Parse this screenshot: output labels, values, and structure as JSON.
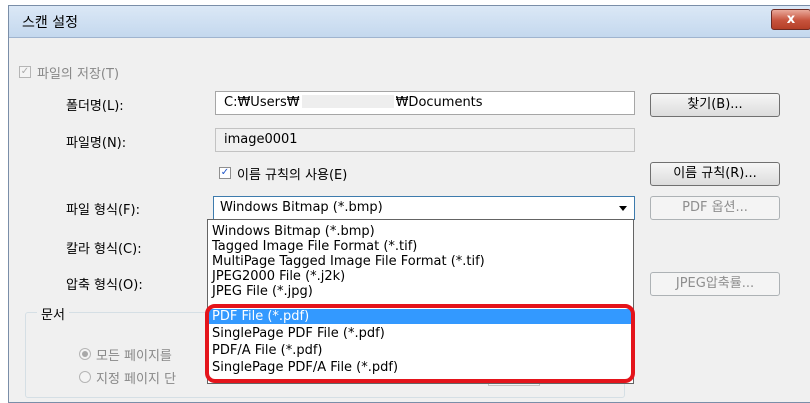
{
  "window": {
    "title": "스캔 설정",
    "close_label": "x"
  },
  "save_file": {
    "label": "파일의 저장(T)",
    "checked": true
  },
  "folder": {
    "label": "폴더명(L):",
    "value": "C:₩Users₩",
    "value_tail": "₩Documents",
    "browse_label": "찾기(B)..."
  },
  "filename": {
    "label": "파일명(N):",
    "value": "image0001"
  },
  "naming_rule": {
    "checkbox_label": "이름 규칙의 사용(E)",
    "checked": true,
    "button_label": "이름 규칙(R)..."
  },
  "file_format": {
    "label": "파일 형식(F):",
    "selected": "Windows Bitmap (*.bmp)",
    "pdf_options_label": "PDF 옵션..."
  },
  "color_format": {
    "label": "칼라 형식(C):"
  },
  "compression": {
    "label": "압축 형식(O):",
    "jpeg_button_label": "JPEG압축률..."
  },
  "dropdown": {
    "options": [
      "Windows Bitmap (*.bmp)",
      "Tagged Image File Format (*.tif)",
      "MultiPage Tagged Image File Format (*.tif)",
      "JPEG2000 File (*.j2k)",
      "JPEG File (*.jpg)",
      "PDF File (*.pdf)",
      "SinglePage PDF File (*.pdf)",
      "PDF/A File (*.pdf)",
      "SinglePage PDF/A File (*.pdf)"
    ],
    "highlighted_index": 5
  },
  "document_group": {
    "title": "문서",
    "radio_all": "모든 페이지를",
    "radio_specific": "지정 페이지 단"
  },
  "colors": {
    "accent_red": "#e4141b",
    "selection": "#3399ff"
  }
}
